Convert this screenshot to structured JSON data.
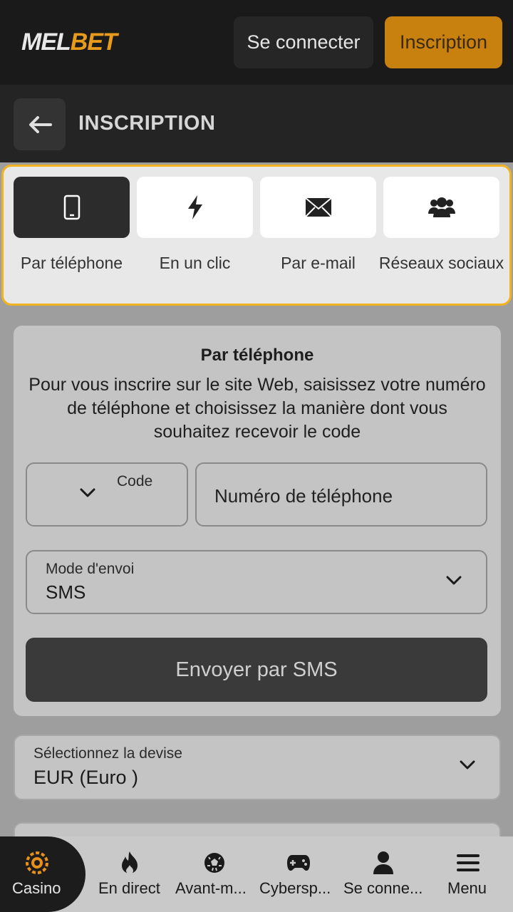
{
  "header": {
    "logo_left": "MEL",
    "logo_right": "BET",
    "login_label": "Se connecter",
    "register_label": "Inscription"
  },
  "subheader": {
    "title": "INSCRIPTION"
  },
  "tabs": [
    {
      "label": "Par téléphone",
      "icon": "phone-icon",
      "active": true
    },
    {
      "label": "En un clic",
      "icon": "lightning-icon",
      "active": false
    },
    {
      "label": "Par e-mail",
      "icon": "envelope-icon",
      "active": false
    },
    {
      "label": "Réseaux sociaux",
      "icon": "users-icon",
      "active": false
    }
  ],
  "form": {
    "title": "Par téléphone",
    "description": "Pour vous inscrire sur le site Web, saisissez votre numéro de téléphone et choisissez la manière dont vous souhaitez recevoir le code",
    "code_label": "Code",
    "phone_placeholder": "Numéro de téléphone",
    "mode_label": "Mode d'envoi",
    "mode_value": "SMS",
    "send_button": "Envoyer par SMS"
  },
  "currency": {
    "label": "Sélectionnez la devise",
    "value": "EUR (Euro )"
  },
  "bottom_nav": [
    {
      "label": "Casino",
      "icon": "casino-chip-icon"
    },
    {
      "label": "En direct",
      "icon": "flame-icon"
    },
    {
      "label": "Avant-m...",
      "icon": "soccer-ball-icon"
    },
    {
      "label": "Cybersp...",
      "icon": "gamepad-icon"
    },
    {
      "label": "Se conne...",
      "icon": "user-icon"
    },
    {
      "label": "Menu",
      "icon": "hamburger-icon"
    }
  ],
  "colors": {
    "accent": "#c8800e",
    "highlight_border": "#f2b320",
    "casino_icon": "#e8901a"
  }
}
